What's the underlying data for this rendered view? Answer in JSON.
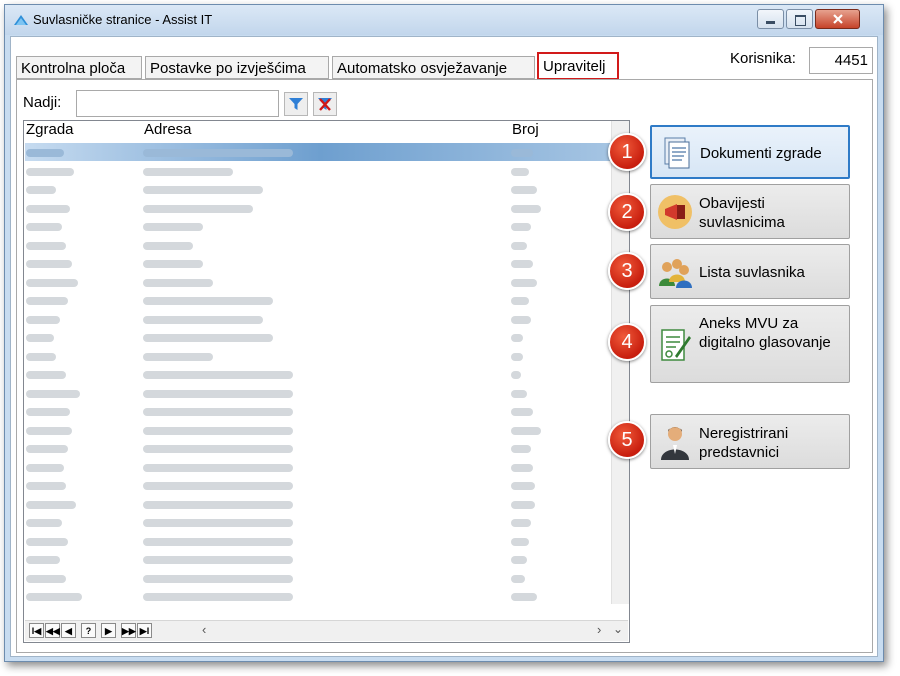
{
  "window": {
    "title": "Suvlasničke stranice - Assist IT"
  },
  "tabs": [
    {
      "label": "Kontrolna ploča"
    },
    {
      "label": "Postavke po izvješćima"
    },
    {
      "label": "Automatsko osvježavanje"
    },
    {
      "label": "Upravitelj",
      "active": true
    }
  ],
  "users": {
    "label": "Korisnika:",
    "value": "4451"
  },
  "search": {
    "label": "Nadji:",
    "value": ""
  },
  "grid": {
    "columns": [
      "Zgrada",
      "Adresa",
      "Broj"
    ],
    "selected_row": 0,
    "blurred_rows": 25
  },
  "actions": [
    {
      "number": "1",
      "label": "Dokumenti zgrade",
      "icon": "document-icon"
    },
    {
      "number": "2",
      "label": "Obavijesti suvlasnicima",
      "icon": "megaphone-icon"
    },
    {
      "number": "3",
      "label": "Lista suvlasnika",
      "icon": "people-icon"
    },
    {
      "number": "4",
      "label": "Aneks MVU za digitalno glasovanje",
      "icon": "contract-icon"
    },
    {
      "number": "5",
      "label": "Neregistrirani predstavnici",
      "icon": "representative-icon"
    }
  ],
  "navigator": [
    "first-page",
    "previous-page",
    "previous",
    "help",
    "next",
    "next-page",
    "last"
  ],
  "colors": {
    "accent": "#2f7bc7",
    "badge": "#d6301b",
    "highlight_border": "#d21a1a"
  }
}
